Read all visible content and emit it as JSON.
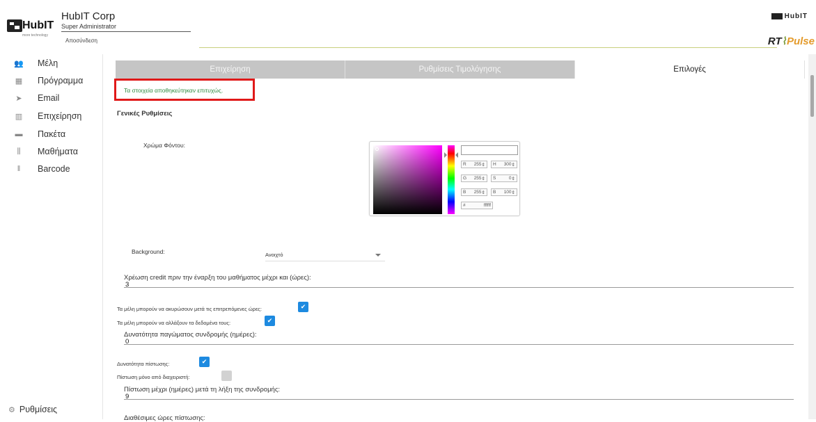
{
  "header": {
    "logo_text": "HubIT",
    "logo_sub": "more technology",
    "company": "HubIT Corp",
    "role": "Super Administrator",
    "logout": "Αποσύνδεση",
    "brand_small": "HubIT",
    "brand_rt": "RT",
    "brand_pulse": "Pulse"
  },
  "sidebar": {
    "items": [
      {
        "label": "Μέλη",
        "icon": "users-icon",
        "glyph": "👥"
      },
      {
        "label": "Πρόγραμμα",
        "icon": "calendar-icon",
        "glyph": "▦"
      },
      {
        "label": "Email",
        "icon": "send-icon",
        "glyph": "➤"
      },
      {
        "label": "Επιχείρηση",
        "icon": "building-icon",
        "glyph": "▥"
      },
      {
        "label": "Πακέτα",
        "icon": "credit-card-icon",
        "glyph": "▬"
      },
      {
        "label": "Μαθήματα",
        "icon": "dumbbell-icon",
        "glyph": "⫼"
      },
      {
        "label": "Barcode",
        "icon": "barcode-icon",
        "glyph": "‖"
      }
    ],
    "settings": {
      "label": "Ρυθμίσεις",
      "icon": "cogs-icon",
      "glyph": "⚙"
    }
  },
  "tabs": [
    {
      "label": "Επιχείρηση",
      "active": false
    },
    {
      "label": "Ρυθμίσεις Τιμολόγησης",
      "active": false
    },
    {
      "label": "Επιλογές",
      "active": true
    }
  ],
  "success_message": "Τα στοιχεία αποθηκεύτηκαν επιτυχώς.",
  "section_title": "Γενικές Ρυθμίσεις",
  "bg_color_label": "Χρώμα Φόντου:",
  "picker": {
    "hex_value": "",
    "r": "255",
    "g": "255",
    "b": "255",
    "h": "300",
    "s": "0",
    "bri": "100",
    "hex": "ffffff",
    "labels": {
      "r": "R",
      "g": "G",
      "b": "B",
      "h": "H",
      "s": "S",
      "bri": "B",
      "hash": "#"
    }
  },
  "background_label": "Background:",
  "background_value": "Ανοιχτό",
  "credit_label": "Χρέωση credit πριν την έναρξη του μαθήματος μέχρι και (ώρες):",
  "credit_value": "3",
  "cancel_label": "Τα μέλη μπορούν να ακυρώσουν μετά τις επιτρεπόμενες ώρες:",
  "change_label": "Τα μέλη μπορούν να αλλάξουν τα δεδομένα τους:",
  "freeze_label": "Δυνατότητα παγώματος συνδρομής (ημέρες):",
  "freeze_value": "0",
  "credit_allow_label": "Δυνατότητα πίστωσης:",
  "credit_admin_label": "Πίστωση μόνο από διαχειριστή:",
  "credit_until_label": "Πίστωση μέχρι (ημέρες) μετά τη λήξη της συνδρομής:",
  "credit_until_value": "9",
  "available_hours_label": "Διαθέσιμες ώρες πίστωσης:",
  "check_glyph": "✔",
  "colors": {
    "accent": "#1d8ae0",
    "success": "#2d8a3e",
    "highlight": "#e01919"
  }
}
